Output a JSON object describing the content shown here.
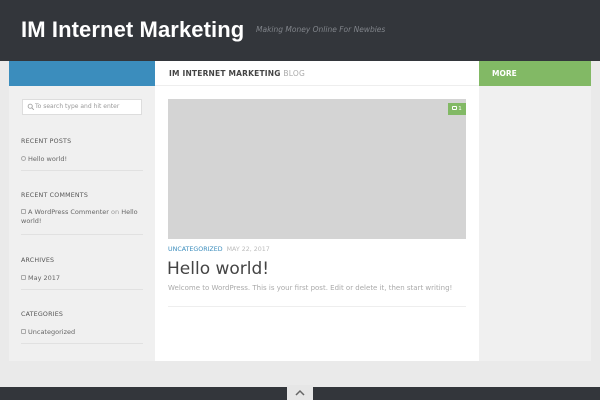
{
  "header": {
    "site_title": "IM Internet Marketing",
    "tagline": "Making Money Online For Newbies"
  },
  "bar": {
    "page_title": "IM INTERNET MARKETING",
    "page_title_suffix": "BLOG",
    "more_label": "MORE"
  },
  "sidebar": {
    "search_placeholder": "To search type and hit enter",
    "recent_posts": {
      "title": "RECENT POSTS",
      "items": [
        "Hello world!"
      ]
    },
    "recent_comments": {
      "title": "RECENT COMMENTS",
      "author": "A WordPress Commenter",
      "on": "on",
      "post": "Hello world!"
    },
    "archives": {
      "title": "ARCHIVES",
      "items": [
        "May 2017"
      ]
    },
    "categories": {
      "title": "CATEGORIES",
      "items": [
        "Uncategorized"
      ]
    }
  },
  "post": {
    "comment_count": "1",
    "category": "UNCATEGORIZED",
    "date": "MAY 22, 2017",
    "title": "Hello world!",
    "excerpt": "Welcome to WordPress. This is your first post. Edit or delete it, then start writing!"
  },
  "colors": {
    "header_bg": "#33363b",
    "accent_blue": "#3b8dbd",
    "accent_green": "#82b965"
  },
  "icons": {
    "search": "search-icon",
    "comment": "comment-icon",
    "scroll_top": "chevron-up-icon"
  }
}
